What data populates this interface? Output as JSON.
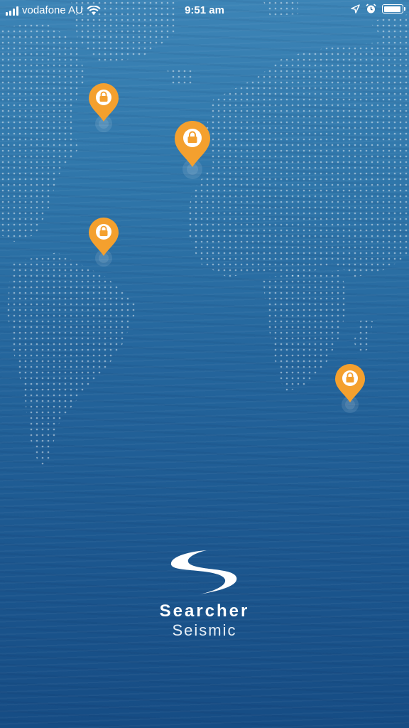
{
  "status_bar": {
    "carrier": "vodafone AU",
    "time": "9:51 am",
    "signal_bars": 4,
    "battery_level": 0.9
  },
  "map": {
    "pin_icon": "lock-icon",
    "pin_color": "#f4a02e",
    "pins": [
      {
        "name": "pin-north-america"
      },
      {
        "name": "pin-north-atlantic"
      },
      {
        "name": "pin-south-america"
      },
      {
        "name": "pin-indian-ocean"
      }
    ]
  },
  "logo": {
    "brand": "Searcher",
    "sub": "Seismic"
  },
  "colors": {
    "ocean_top": "#3c84b6",
    "ocean_bottom": "#164c84",
    "accent": "#f4a02e"
  }
}
